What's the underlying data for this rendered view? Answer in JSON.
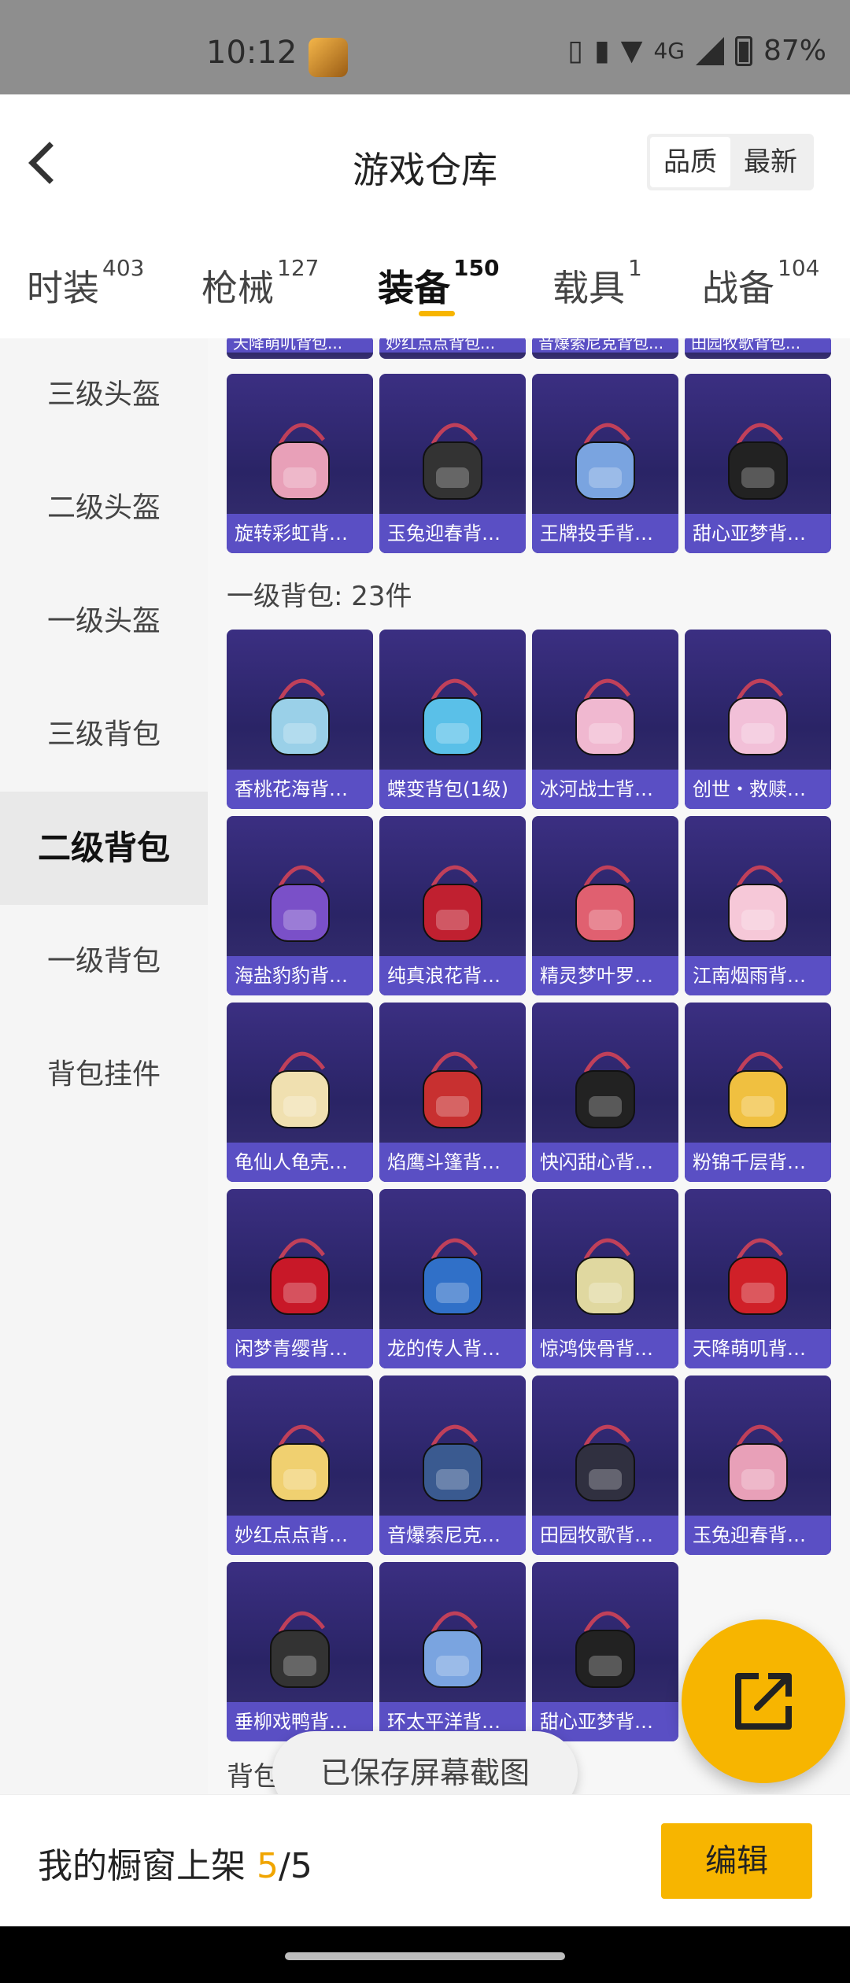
{
  "status_bar": {
    "time": "10:12",
    "network": "4G",
    "battery": "87%"
  },
  "header": {
    "title": "游戏仓库",
    "sort_options": [
      "品质",
      "最新"
    ],
    "sort_active": "品质"
  },
  "tabs": [
    {
      "label": "时装",
      "count": "403"
    },
    {
      "label": "枪械",
      "count": "127"
    },
    {
      "label": "装备",
      "count": "150",
      "active": true
    },
    {
      "label": "载具",
      "count": "1"
    },
    {
      "label": "战备",
      "count": "104"
    }
  ],
  "sidebar": {
    "items": [
      "三级头盔",
      "二级头盔",
      "一级头盔",
      "三级背包",
      "二级背包",
      "一级背包",
      "背包挂件"
    ],
    "active": "二级背包"
  },
  "content": {
    "top_partial_labels": [
      "天降萌叽背包...",
      "妙红点点背包...",
      "音爆索尼克背包...",
      "田园牧歌背包..."
    ],
    "top_row": [
      {
        "name": "旋转彩虹背包..."
      },
      {
        "name": "玉兔迎春背包..."
      },
      {
        "name": "王牌投手背包..."
      },
      {
        "name": "甜心亚梦背包..."
      }
    ],
    "section1_title": "一级背包: 23件",
    "section1_items": [
      {
        "name": "香桃花海背包..."
      },
      {
        "name": "蝶变背包(1级)"
      },
      {
        "name": "冰河战士背包..."
      },
      {
        "name": "创世・救赎背..."
      },
      {
        "name": "海盐豹豹背包..."
      },
      {
        "name": "纯真浪花背包..."
      },
      {
        "name": "精灵梦叶罗丽..."
      },
      {
        "name": "江南烟雨背包..."
      },
      {
        "name": "龟仙人龟壳背..."
      },
      {
        "name": "焰鹰斗篷背包..."
      },
      {
        "name": "快闪甜心背包..."
      },
      {
        "name": "粉锦千层背包..."
      },
      {
        "name": "闲梦青缨背包..."
      },
      {
        "name": "龙的传人背包..."
      },
      {
        "name": "惊鸿侠骨背包..."
      },
      {
        "name": "天降萌叽背包..."
      },
      {
        "name": "妙红点点背包..."
      },
      {
        "name": "音爆索尼克背..."
      },
      {
        "name": "田园牧歌背包..."
      },
      {
        "name": "玉兔迎春背包..."
      },
      {
        "name": "垂柳戏鸭背包..."
      },
      {
        "name": "环太平洋背包..."
      },
      {
        "name": "甜心亚梦背包..."
      }
    ],
    "section2_title_partial": "背包"
  },
  "toast": "已保存屏幕截图",
  "bottom_bar": {
    "label": "我的橱窗上架 ",
    "current": "5",
    "total": "/5",
    "edit_label": "编辑"
  },
  "colors": {
    "accent": "#f7b500",
    "card_bg": "#2a2466",
    "card_label": "#5a4fc4"
  }
}
